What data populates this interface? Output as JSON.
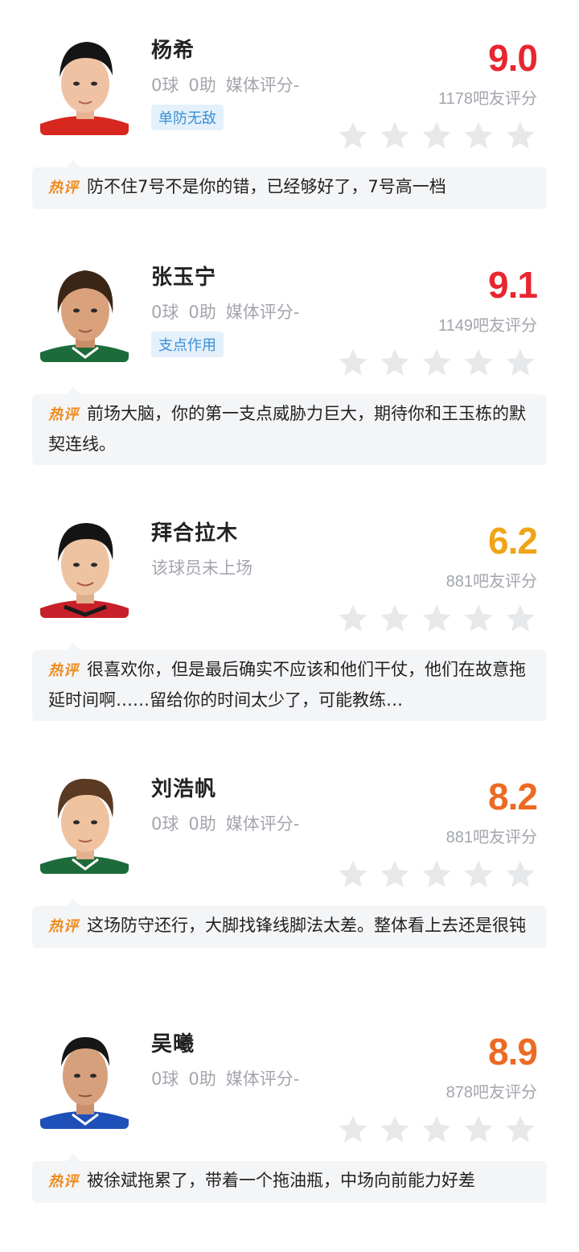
{
  "colors": {
    "score_high": "#e8262f",
    "score_mid": "#f0a418",
    "score_orange": "#ec6a23",
    "tag_text": "#3a8fd6",
    "tag_bg": "#e4f1fb",
    "star_empty": "#e7e8ea",
    "hot_badge": "#f08a1b"
  },
  "hot_label": "热评",
  "players": [
    {
      "name": "杨希",
      "goals": "0球",
      "assists": "0助",
      "media_rating": "媒体评分-",
      "tag": "单防无敌",
      "score": "9.0",
      "votes": "1178吧友评分",
      "comment": "防不住7号不是你的错，已经够好了，7号高一档",
      "avatar_icon": "player-portrait-icon"
    },
    {
      "name": "张玉宁",
      "goals": "0球",
      "assists": "0助",
      "media_rating": "媒体评分-",
      "tag": "支点作用",
      "score": "9.1",
      "votes": "1149吧友评分",
      "comment": "前场大脑，你的第一支点威胁力巨大，期待你和王玉栋的默契连线。",
      "avatar_icon": "player-portrait-icon"
    },
    {
      "name": "拜合拉木",
      "status": "该球员未上场",
      "score": "6.2",
      "votes": "881吧友评分",
      "comment": "很喜欢你，但是最后确实不应该和他们干仗，他们在故意拖延时间啊……留给你的时间太少了，可能教练…",
      "avatar_icon": "player-portrait-icon"
    },
    {
      "name": "刘浩帆",
      "goals": "0球",
      "assists": "0助",
      "media_rating": "媒体评分-",
      "score": "8.2",
      "votes": "881吧友评分",
      "comment": "这场防守还行，大脚找锋线脚法太差。整体看上去还是很钝",
      "avatar_icon": "player-portrait-icon"
    },
    {
      "name": "吴曦",
      "goals": "0球",
      "assists": "0助",
      "media_rating": "媒体评分-",
      "score": "8.9",
      "votes": "878吧友评分",
      "comment": "被徐斌拖累了，带着一个拖油瓶，中场向前能力好差",
      "avatar_icon": "player-portrait-icon"
    }
  ],
  "star_icon": "star-icon",
  "star_count": 5
}
